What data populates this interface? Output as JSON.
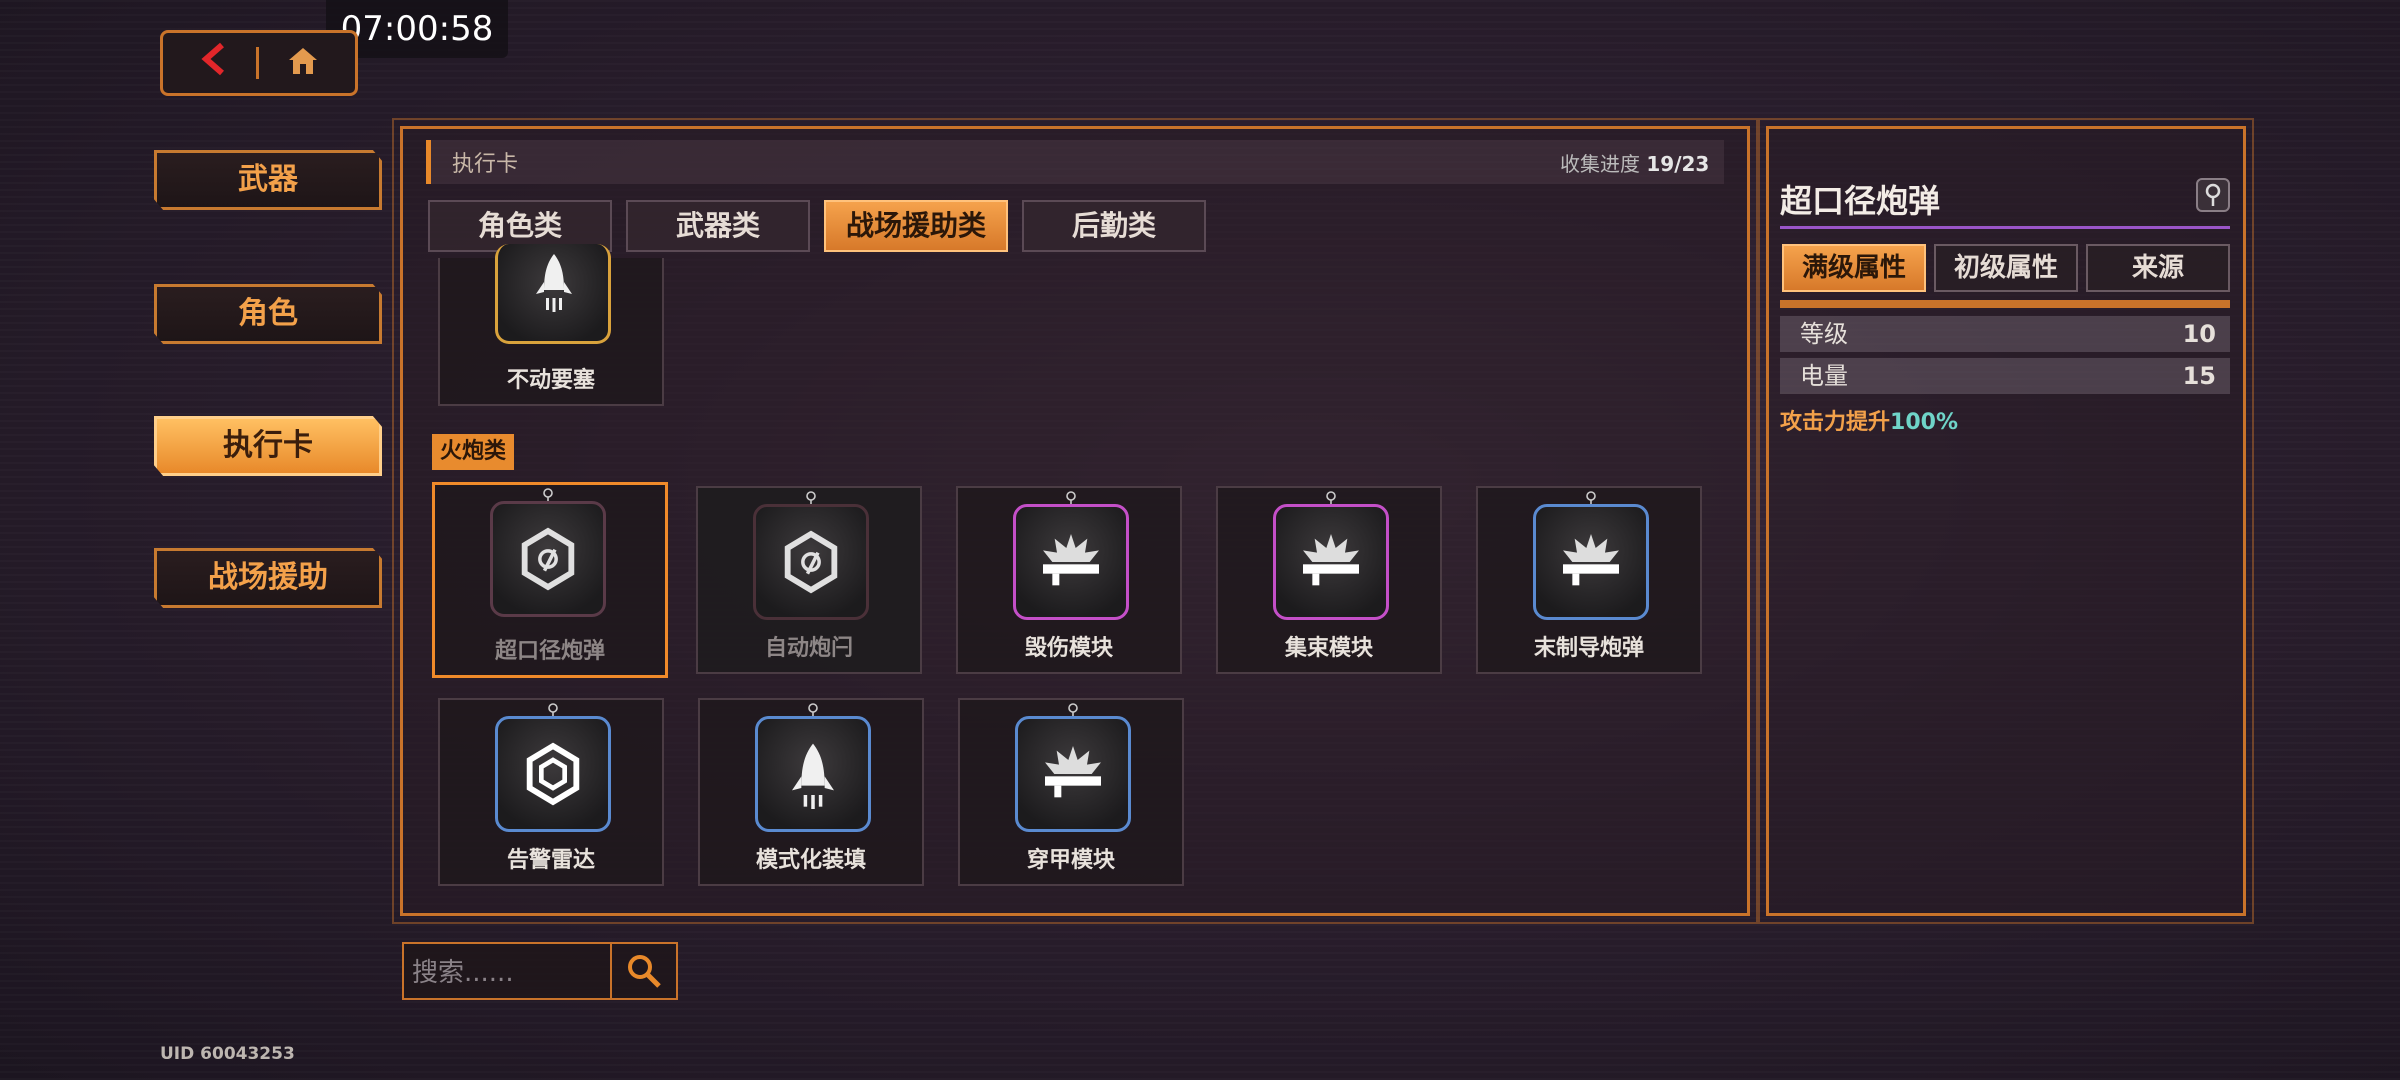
{
  "status": {
    "time": "07:00:58"
  },
  "nav": {
    "back_icon": "chevron-left-icon",
    "home_icon": "home-icon"
  },
  "left_menu": [
    {
      "label": "武器",
      "active": false
    },
    {
      "label": "角色",
      "active": false
    },
    {
      "label": "执行卡",
      "active": true
    },
    {
      "label": "战场援助",
      "active": false
    }
  ],
  "panel": {
    "title": "执行卡",
    "progress_label": "收集进度",
    "progress_value": "19/23",
    "tabs": [
      {
        "label": "角色类",
        "active": false
      },
      {
        "label": "武器类",
        "active": false
      },
      {
        "label": "战场援助类",
        "active": true
      },
      {
        "label": "后勤类",
        "active": false
      }
    ],
    "top_card": {
      "label": "不动要塞",
      "icon": "rocket-icon",
      "border": "#d9a23c"
    },
    "section_label": "火炮类",
    "cards": [
      {
        "label": "超口径炮弹",
        "icon": "hex-lock-icon",
        "border": "#5a3a48",
        "state": "selected"
      },
      {
        "label": "自动炮闩",
        "icon": "hex-lock-icon",
        "border": "#4a3038",
        "state": "locked"
      },
      {
        "label": "毁伤模块",
        "icon": "rifle-burst-icon",
        "border": "#c44fc8",
        "state": "normal"
      },
      {
        "label": "集束模块",
        "icon": "rifle-burst-icon",
        "border": "#c44fc8",
        "state": "normal"
      },
      {
        "label": "末制导炮弹",
        "icon": "rifle-burst-icon",
        "border": "#5a8ad0",
        "state": "normal"
      },
      {
        "label": "告警雷达",
        "icon": "hex-radar-icon",
        "border": "#5a8ad0",
        "state": "normal"
      },
      {
        "label": "模式化装填",
        "icon": "rocket-icon",
        "border": "#5a8ad0",
        "state": "normal"
      },
      {
        "label": "穿甲模块",
        "icon": "rifle-burst-icon",
        "border": "#5a8ad0",
        "state": "normal"
      }
    ]
  },
  "detail": {
    "title": "超口径炮弹",
    "pin_icon": "pin-icon",
    "tabs": [
      {
        "label": "满级属性",
        "active": true
      },
      {
        "label": "初级属性",
        "active": false
      },
      {
        "label": "来源",
        "active": false
      }
    ],
    "stats": [
      {
        "key": "等级",
        "value": "10"
      },
      {
        "key": "电量",
        "value": "15"
      }
    ],
    "bonus_text": "攻击力提升",
    "bonus_value": "100%"
  },
  "search": {
    "placeholder": "搜索......",
    "value": "",
    "icon": "search-icon"
  },
  "uid": "UID 60043253",
  "colors": {
    "accent": "#e8892a",
    "frame": "#c9732a",
    "text_orange": "#f3a14a",
    "cyan": "#6fd4c8"
  }
}
